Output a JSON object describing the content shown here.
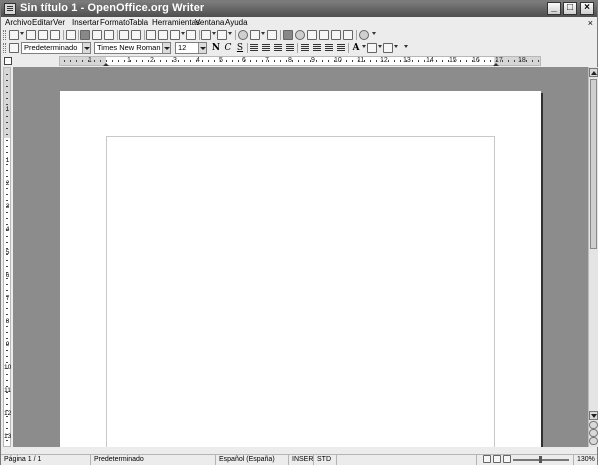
{
  "window": {
    "title": "Sin título 1 - OpenOffice.org Writer"
  },
  "titlebar_buttons": {
    "minimize": "_",
    "maximize": "□",
    "close": "×"
  },
  "menu": {
    "items": [
      "Archivo",
      "Editar",
      "Ver",
      "Insertar",
      "Formato",
      "Tabla",
      "Herramientas",
      "Ventana",
      "Ayuda"
    ],
    "close_doc": "×"
  },
  "toolbar_standard": {
    "icons": [
      "new-icon",
      "open-icon",
      "save-icon",
      "email-icon",
      "edit-file-icon",
      "export-pdf-icon",
      "print-icon",
      "print-preview-icon",
      "spellcheck-icon",
      "autospellcheck-icon",
      "cut-icon",
      "copy-icon",
      "paste-icon",
      "format-paintbrush-icon",
      "undo-icon",
      "redo-icon",
      "hyperlink-icon",
      "table-icon",
      "show-draw-functions-icon",
      "find-replace-icon",
      "navigator-icon",
      "gallery-icon",
      "data-sources-icon",
      "nonprinting-characters-icon",
      "zoom-icon",
      "help-icon"
    ]
  },
  "toolbar_format": {
    "paragraph_style": "Predeterminado",
    "font_name": "Times New Roman",
    "font_size": "12",
    "bold": "N",
    "italic": "C",
    "underline": "S"
  },
  "ruler": {
    "labels": [
      "1",
      "1",
      "2",
      "3",
      "4",
      "5",
      "6",
      "7",
      "8",
      "9",
      "10",
      "11",
      "12",
      "13",
      "14",
      "15",
      "16",
      "17",
      "18"
    ]
  },
  "vruler": {
    "labels": [
      "1",
      "1",
      "2",
      "3",
      "4",
      "5",
      "6",
      "7",
      "8",
      "9",
      "10",
      "11",
      "12",
      "13"
    ]
  },
  "status": {
    "page": "Página  1 / 1",
    "style": "Predeterminado",
    "language": "Español (España)",
    "insert": "INSERT",
    "selection": "STD",
    "zoom": "130%"
  }
}
